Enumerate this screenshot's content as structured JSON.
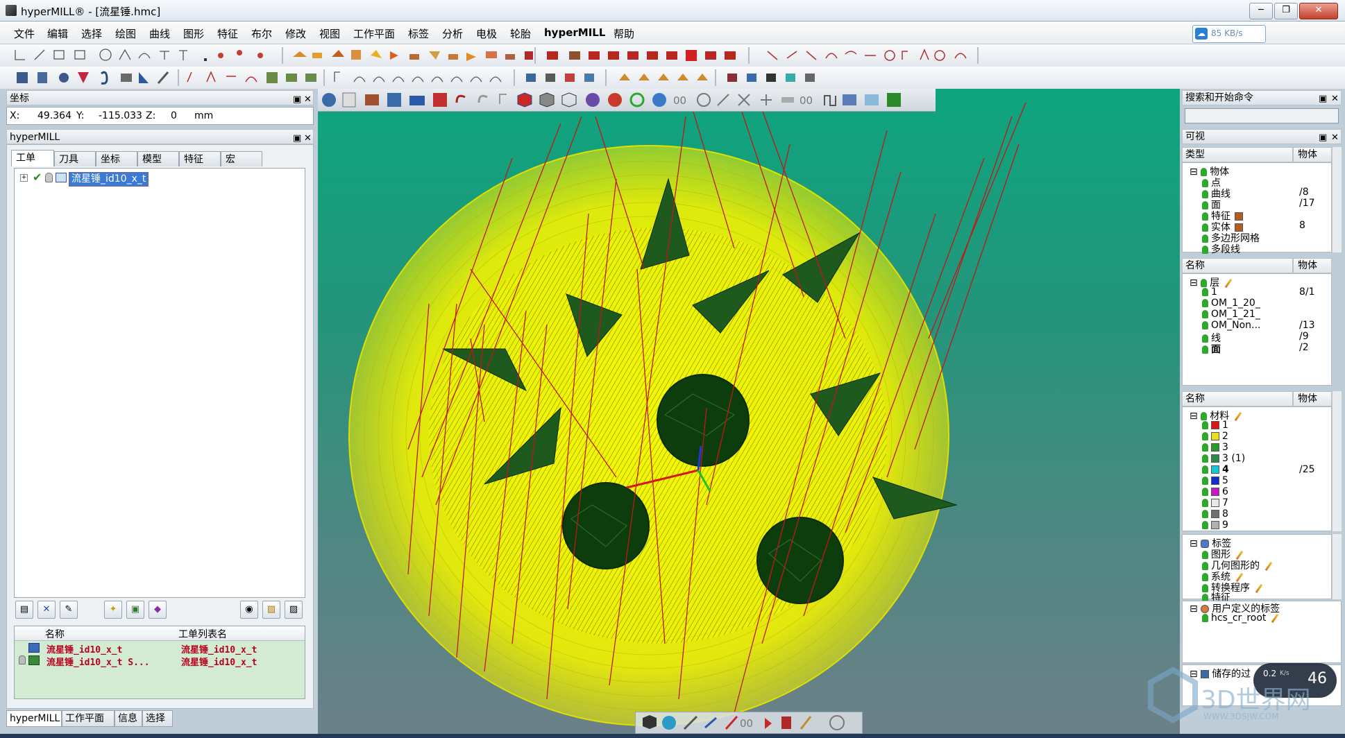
{
  "window": {
    "title": "hyperMILL® - [流星锤.hmc]",
    "minimize": "─",
    "maximize": "❐",
    "close": "✕"
  },
  "menu": [
    "文件",
    "编辑",
    "选择",
    "绘图",
    "曲线",
    "图形",
    "特征",
    "布尔",
    "修改",
    "视图",
    "工作平面",
    "标签",
    "分析",
    "电极",
    "轮胎",
    "hyperMILL",
    "帮助"
  ],
  "network": {
    "speed": "85 KB/s"
  },
  "coord_panel": {
    "title": "坐标",
    "x_label": "X:",
    "x_value": "49.364",
    "y_label": "Y:",
    "y_value": "-115.033",
    "z_label": "Z:",
    "z_value": "0",
    "unit": "mm"
  },
  "hypermill_panel": {
    "title": "hyperMILL",
    "tabs": [
      "工单",
      "刀具",
      "坐标",
      "模型",
      "特征",
      "宏"
    ],
    "job_item": "流星锤_id10_x_t",
    "list_headers": {
      "name": "名称",
      "joblist": "工单列表名"
    },
    "rows": [
      {
        "name": "流星锤_id10_x_t",
        "joblist": "流星锤_id10_x_t"
      },
      {
        "name": "流星锤_id10_x_t S...",
        "joblist": "流星锤_id10_x_t"
      }
    ],
    "bottom_tabs": [
      "hyperMILL",
      "工作平面",
      "信息",
      "选择"
    ]
  },
  "search_panel": {
    "title": "搜索和开始命令"
  },
  "visibility_panel": {
    "title": "可视",
    "type_header": "类型",
    "object_header": "物体",
    "type_tree": [
      {
        "label": "物体",
        "count": ""
      },
      {
        "label": "点",
        "count": ""
      },
      {
        "label": "曲线",
        "count": "/8"
      },
      {
        "label": "面",
        "count": "/17"
      },
      {
        "label": "特征",
        "count": ""
      },
      {
        "label": "实体",
        "count": "8"
      },
      {
        "label": "多边形网格",
        "count": ""
      },
      {
        "label": "多段线",
        "count": ""
      }
    ],
    "name_header": "名称",
    "layers": [
      {
        "label": "层",
        "count": ""
      },
      {
        "label": "1",
        "count": "8/1"
      },
      {
        "label": "OM_1_20_",
        "count": ""
      },
      {
        "label": "OM_1_21_",
        "count": ""
      },
      {
        "label": "OM_Non...",
        "count": "/13"
      },
      {
        "label": "线",
        "count": "/9"
      },
      {
        "label": "面",
        "count": "/2"
      }
    ],
    "materials": [
      {
        "label": "材料",
        "count": "",
        "color": ""
      },
      {
        "label": "1",
        "count": "",
        "color": "#d81818"
      },
      {
        "label": "2",
        "count": "",
        "color": "#e8e020"
      },
      {
        "label": "3",
        "count": "",
        "color": "#2a9a2a"
      },
      {
        "label": "3 (1)",
        "count": "",
        "color": "#2a8a4a"
      },
      {
        "label": "4",
        "count": "/25",
        "color": "#18c8d8"
      },
      {
        "label": "5",
        "count": "",
        "color": "#1030c8"
      },
      {
        "label": "6",
        "count": "",
        "color": "#c818c8"
      },
      {
        "label": "7",
        "count": "",
        "color": "#e8e8e8"
      },
      {
        "label": "8",
        "count": "",
        "color": "#707070"
      },
      {
        "label": "9",
        "count": "",
        "color": "#b0b0b0"
      }
    ],
    "tags": [
      {
        "label": "标签"
      },
      {
        "label": "图形"
      },
      {
        "label": "几何图形的"
      },
      {
        "label": "系统"
      },
      {
        "label": "转换程序"
      },
      {
        "label": "特征"
      }
    ],
    "user_tags": [
      {
        "label": "用户定义的标签"
      },
      {
        "label": "hcs_cr_root"
      }
    ],
    "saved": "储存的过"
  },
  "overlay": {
    "speed": "0.2",
    "speed_unit": "K/s",
    "badge": "46"
  },
  "watermark": {
    "text": "3D世界网",
    "url": "WWW.3DSJW.COM"
  }
}
